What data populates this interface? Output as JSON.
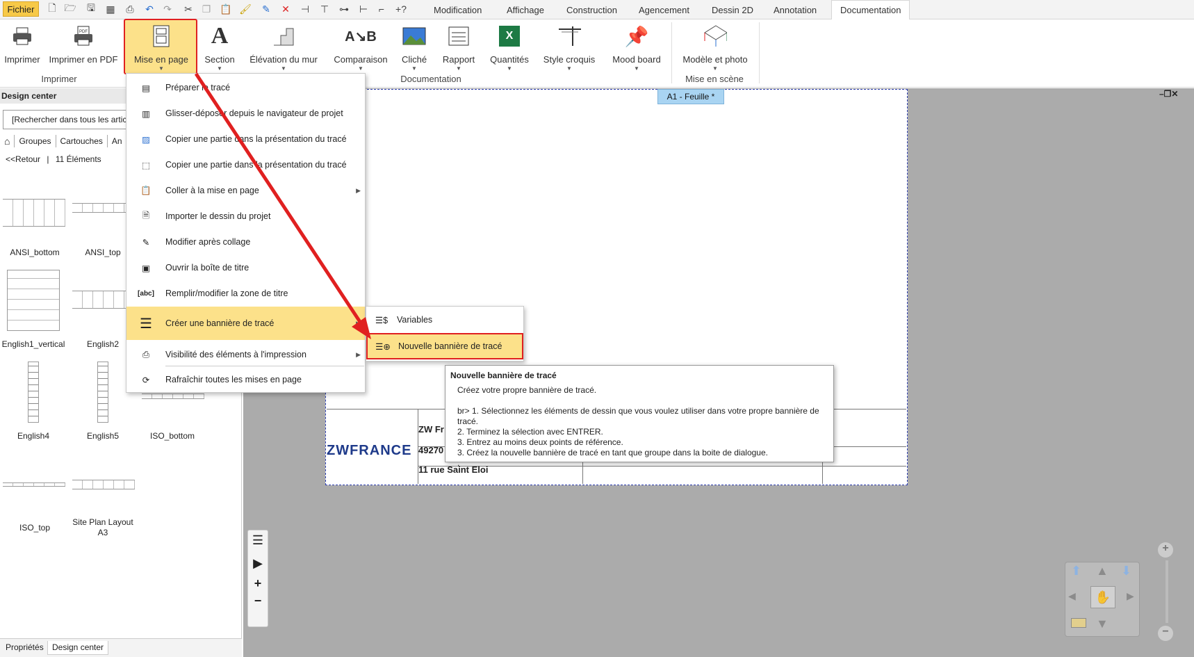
{
  "menu_bar": {
    "file_label": "Fichier",
    "tabs": [
      "Modification",
      "Affichage",
      "Construction",
      "Agencement",
      "Dessin 2D",
      "Annotation",
      "Documentation"
    ],
    "active_tab": "Documentation"
  },
  "ribbon": {
    "buttons": [
      {
        "label": "Imprimer",
        "icon": "printer-icon"
      },
      {
        "label": "Imprimer en PDF",
        "icon": "pdf-printer-icon"
      },
      {
        "label": "Mise en page",
        "icon": "layout-icon"
      },
      {
        "label": "Section",
        "icon": "section-icon"
      },
      {
        "label": "Élévation du mur",
        "icon": "wall-elevation-icon"
      },
      {
        "label": "Comparaison",
        "icon": "compare-icon"
      },
      {
        "label": "Cliché",
        "icon": "snapshot-icon"
      },
      {
        "label": "Rapport",
        "icon": "report-icon"
      },
      {
        "label": "Quantités",
        "icon": "excel-icon"
      },
      {
        "label": "Style croquis",
        "icon": "sketch-style-icon"
      },
      {
        "label": "Mood board",
        "icon": "pin-icon"
      },
      {
        "label": "Modèle et photo",
        "icon": "model-photo-icon"
      }
    ],
    "groups": [
      "Imprimer",
      "Documentation",
      "Mise en scène"
    ]
  },
  "design_center": {
    "title": "Design center",
    "search_value": "[Rechercher dans tous les articl",
    "breadcrumb": [
      "Groupes",
      "Cartouches",
      "An"
    ],
    "back_label": "<<Retour",
    "count_label": "11 Éléments",
    "items": [
      "ANSI_bottom",
      "ANSI_top",
      "English1_vertical",
      "English2",
      "English4",
      "English5",
      "ISO_bottom",
      "ISO_top",
      "Site Plan Layout A3"
    ]
  },
  "bottom_tabs": [
    "Propriétés",
    "Design center"
  ],
  "sheet": {
    "tab_label": "A1 - Feuille *",
    "company_logo": "ZWFRANCE",
    "company_name": "ZW Fr",
    "postcode": "49270",
    "address": "11 rue Saint Eloi"
  },
  "dropdown_menu": {
    "items": [
      {
        "label": "Préparer le tracé",
        "icon": "prepare-plot-icon"
      },
      {
        "label": "Glisser-déposer depuis le navigateur de projet",
        "icon": "drag-drop-icon"
      },
      {
        "label": "Copier une partie dans la présentation du tracé",
        "icon": "copy-part-hatch-icon"
      },
      {
        "label": "Copier une partie dans la présentation du tracé",
        "icon": "copy-part-frame-icon"
      },
      {
        "label": "Coller à la mise en page",
        "icon": "paste-icon",
        "submenu": true
      },
      {
        "label": "Importer le dessin du projet",
        "icon": "import-drawing-icon"
      },
      {
        "label": "Modifier après collage",
        "icon": "edit-after-paste-icon"
      },
      {
        "label": "Ouvrir la boîte de titre",
        "icon": "open-title-box-icon"
      },
      {
        "label": "Remplir/modifier la zone de titre",
        "icon": "fill-title-icon"
      },
      {
        "label": "Créer une bannière de tracé",
        "icon": "banner-icon",
        "submenu": true,
        "highlighted": true
      },
      {
        "label": "Visibilité des éléments à l'impression",
        "icon": "print-visibility-icon",
        "submenu": true
      },
      {
        "label": "Rafraîchir toutes les mises en page",
        "icon": "refresh-icon"
      }
    ]
  },
  "submenu": {
    "items": [
      {
        "label": "Variables",
        "icon": "variables-icon"
      },
      {
        "label": "Nouvelle bannière de tracé",
        "icon": "new-banner-icon",
        "highlighted": true
      }
    ]
  },
  "tooltip": {
    "title": "Nouvelle bannière de tracé",
    "subtitle": "Créez votre propre bannière de tracé.",
    "lines": [
      "br> 1. Sélectionnez les éléments de dessin que vous voulez utiliser dans votre propre bannière de tracé.",
      "2. Terminez la sélection avec ENTRER.",
      "3. Entrez au moins deux points de référence.",
      "3. Créez la nouvelle bannière de tracé en tant que groupe dans la boite de dialogue.",
      "."
    ]
  },
  "colors": {
    "accent": "#f7c948",
    "highlight": "#fce18a",
    "annotation_red": "#e02020",
    "sheet_tab": "#a9d4f2",
    "workspace": "#ababab"
  }
}
